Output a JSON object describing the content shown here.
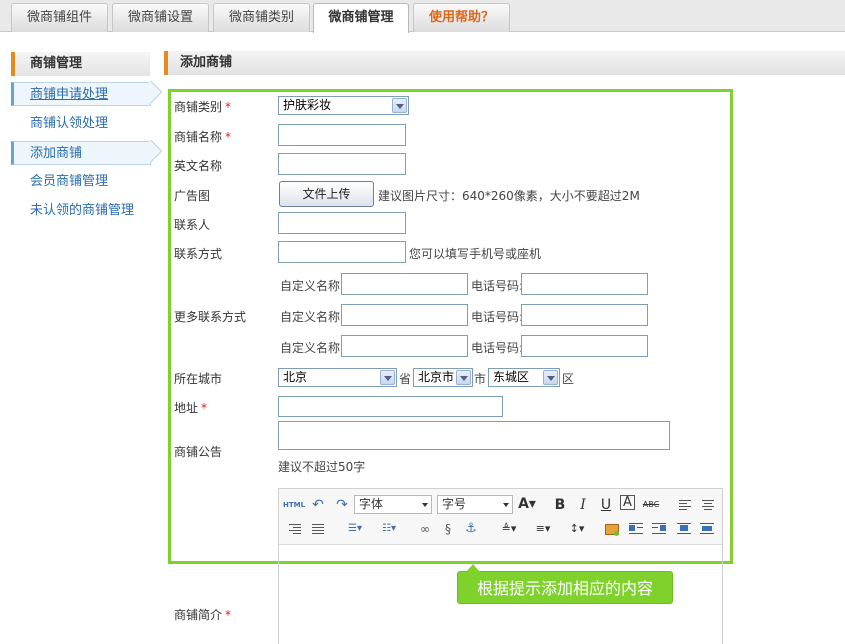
{
  "tabs": [
    {
      "label": "微商铺组件"
    },
    {
      "label": "微商铺设置"
    },
    {
      "label": "微商铺类别"
    },
    {
      "label": "微商铺管理"
    },
    {
      "label": "使用帮助？"
    }
  ],
  "sidebar": {
    "title": "商铺管理",
    "items": [
      {
        "label": "商铺申请处理"
      },
      {
        "label": "商铺认领处理"
      },
      {
        "label": "添加商铺"
      },
      {
        "label": "会员商铺管理"
      },
      {
        "label": "未认领的商铺管理"
      }
    ]
  },
  "main": {
    "title": "添加商铺"
  },
  "form": {
    "category_label": "商铺类别",
    "category_value": "护肤彩妆",
    "name_label": "商铺名称",
    "en_name_label": "英文名称",
    "ad_label": "广告图",
    "upload_button": "文件上传",
    "ad_hint": "建议图片尺寸：640*260像素，大小不要超过2M",
    "contact_label": "联系人",
    "contact_method_label": "联系方式",
    "contact_method_hint": "您可以填写手机号或座机",
    "more_contact_label": "更多联系方式",
    "custom_name_label": "自定义名称:",
    "phone_label": "电话号码:",
    "city_label": "所在城市",
    "province_value": "北京",
    "province_suffix": "省",
    "city_value": "北京市",
    "city_suffix": "市",
    "district_value": "东城区",
    "district_suffix": "区",
    "address_label": "地址",
    "notice_label": "商铺公告",
    "notice_hint": "建议不超过50字",
    "intro_label": "商铺简介",
    "required_mark": "*"
  },
  "editor": {
    "font_family": "字体",
    "font_size": "字号",
    "html_label": "HTML"
  },
  "tooltip": "根据提示添加相应的内容",
  "colors": {
    "accent_green": "#7fd12b",
    "accent_orange": "#e68a1f",
    "link_blue": "#2a6db0"
  }
}
